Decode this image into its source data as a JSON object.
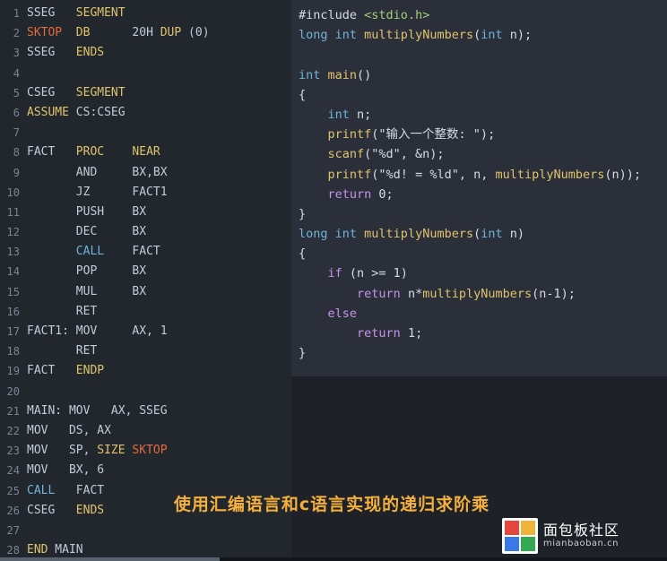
{
  "asm": {
    "lines": [
      {
        "n": "1",
        "code": "SSEG   SEGMENT"
      },
      {
        "n": "2",
        "code": "SKTOP  DB      20H DUP (0)"
      },
      {
        "n": "3",
        "code": "SSEG   ENDS"
      },
      {
        "n": "4",
        "code": ""
      },
      {
        "n": "5",
        "code": "CSEG   SEGMENT"
      },
      {
        "n": "6",
        "code": "ASSUME CS:CSEG"
      },
      {
        "n": "7",
        "code": ""
      },
      {
        "n": "8",
        "code": "FACT   PROC    NEAR"
      },
      {
        "n": "9",
        "code": "       AND     BX,BX"
      },
      {
        "n": "10",
        "code": "       JZ      FACT1"
      },
      {
        "n": "11",
        "code": "       PUSH    BX"
      },
      {
        "n": "12",
        "code": "       DEC     BX"
      },
      {
        "n": "13",
        "code": "       CALL    FACT"
      },
      {
        "n": "14",
        "code": "       POP     BX"
      },
      {
        "n": "15",
        "code": "       MUL     BX"
      },
      {
        "n": "16",
        "code": "       RET"
      },
      {
        "n": "17",
        "code": "FACT1: MOV     AX, 1"
      },
      {
        "n": "18",
        "code": "       RET"
      },
      {
        "n": "19",
        "code": "FACT   ENDP"
      },
      {
        "n": "20",
        "code": ""
      },
      {
        "n": "21",
        "code": "MAIN: MOV   AX, SSEG"
      },
      {
        "n": "22",
        "code": "MOV   DS, AX"
      },
      {
        "n": "23",
        "code": "MOV   SP, SIZE SKTOP"
      },
      {
        "n": "24",
        "code": "MOV   BX, 6"
      },
      {
        "n": "25",
        "code": "CALL   FACT"
      },
      {
        "n": "26",
        "code": "CSEG   ENDS"
      },
      {
        "n": "27",
        "code": ""
      },
      {
        "n": "28",
        "code": "END MAIN"
      }
    ]
  },
  "c": {
    "lines": [
      "#include <stdio.h>",
      "long int multiplyNumbers(int n);",
      "",
      "int main()",
      "{",
      "    int n;",
      "    printf(\"输入一个整数: \");",
      "    scanf(\"%d\", &n);",
      "    printf(\"%d! = %ld\", n, multiplyNumbers(n));",
      "    return 0;",
      "}",
      "long int multiplyNumbers(int n)",
      "{",
      "    if (n >= 1)",
      "        return n*multiplyNumbers(n-1);",
      "    else",
      "        return 1;",
      "}"
    ]
  },
  "caption": {
    "text": "使用汇编语言和c语言实现的递归求阶乘",
    "color": "#f5b03c"
  },
  "watermark": {
    "cn": "面包板社区",
    "en": "mianbaoban.cn",
    "logo_icon": "four-square-logo-icon",
    "colors": [
      "#e8453c",
      "#f2b33d",
      "#3b78e7",
      "#35a853"
    ]
  },
  "scrollbar": {
    "orientation": "horizontal"
  }
}
